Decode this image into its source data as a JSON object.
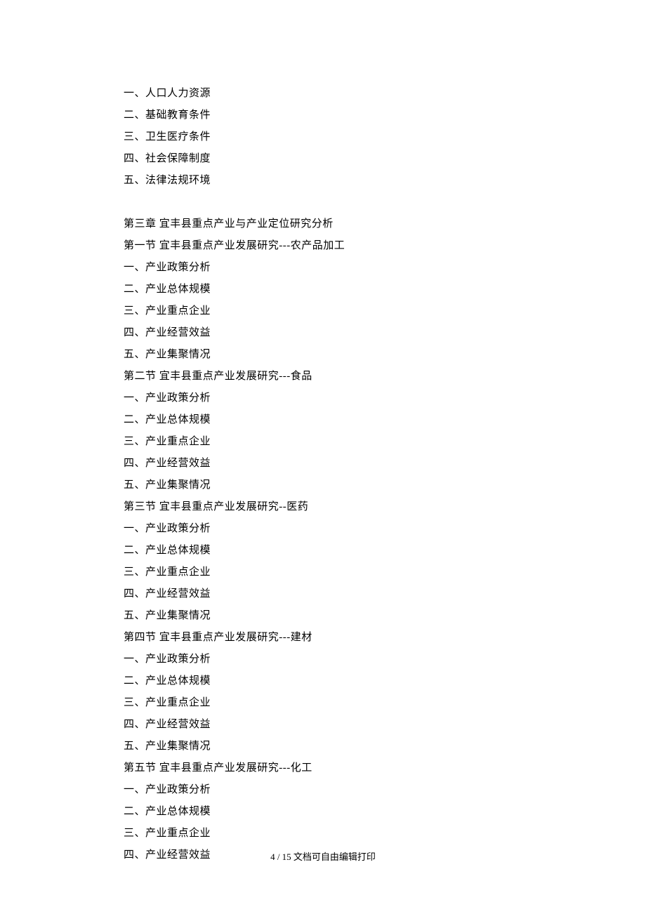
{
  "lines": [
    "一、人口人力资源",
    "二、基础教育条件",
    "三、卫生医疗条件",
    "四、社会保障制度",
    "五、法律法规环境",
    "",
    "第三章 宜丰县重点产业与产业定位研究分析",
    "第一节 宜丰县重点产业发展研究---农产品加工",
    "一、产业政策分析",
    "二、产业总体规模",
    "三、产业重点企业",
    "四、产业经营效益",
    "五、产业集聚情况",
    "第二节 宜丰县重点产业发展研究---食品",
    "一、产业政策分析",
    "二、产业总体规模",
    "三、产业重点企业",
    "四、产业经营效益",
    "五、产业集聚情况",
    "第三节 宜丰县重点产业发展研究--医药",
    "一、产业政策分析",
    "二、产业总体规模",
    "三、产业重点企业",
    "四、产业经营效益",
    "五、产业集聚情况",
    "第四节 宜丰县重点产业发展研究---建材",
    "一、产业政策分析",
    "二、产业总体规模",
    "三、产业重点企业",
    "四、产业经营效益",
    "五、产业集聚情况",
    "第五节 宜丰县重点产业发展研究---化工",
    "一、产业政策分析",
    "二、产业总体规模",
    "三、产业重点企业",
    "四、产业经营效益"
  ],
  "footer": "4 / 15 文档可自由编辑打印"
}
